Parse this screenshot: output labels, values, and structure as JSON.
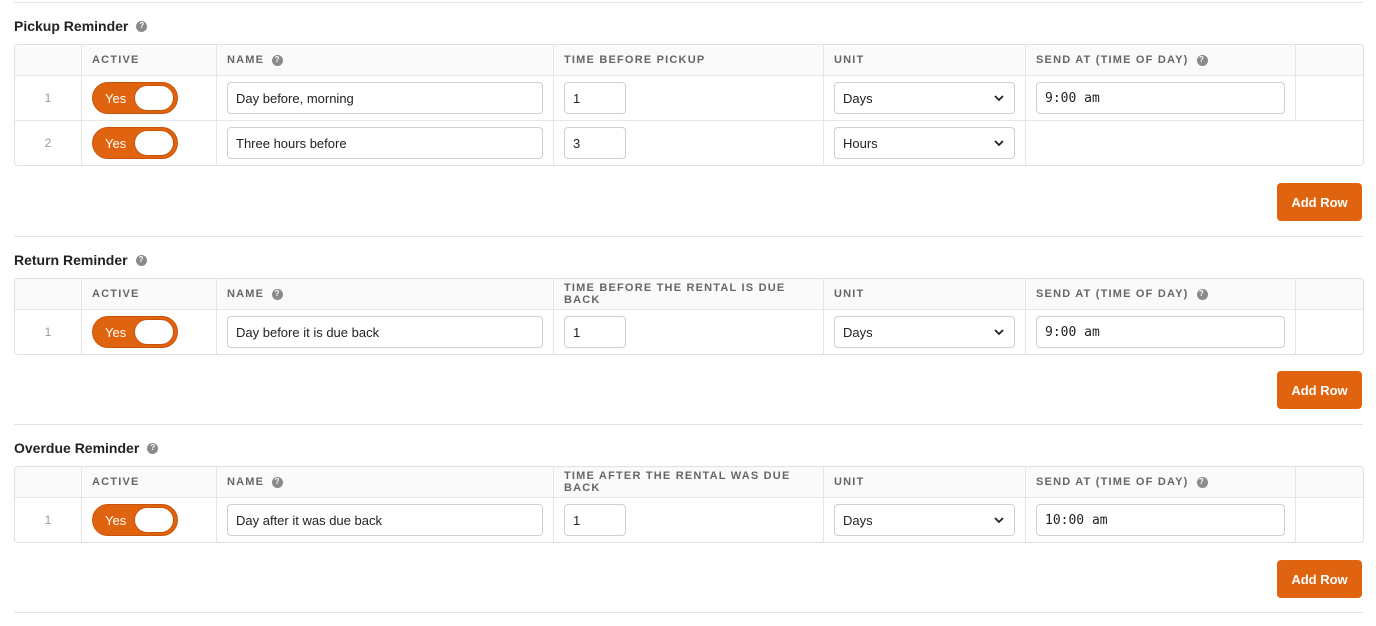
{
  "columns": {
    "active": "Active",
    "name": "Name",
    "unit": "Unit",
    "send_at": "Send at (Time of day)"
  },
  "add_row_label": "Add Row",
  "sections": [
    {
      "title": "Pickup Reminder",
      "time_header": "Time before pickup",
      "rows": [
        {
          "num": "1",
          "active": "Yes",
          "name": "Day before, morning",
          "time": "1",
          "unit": "Days",
          "send_at": "9:00 am"
        },
        {
          "num": "2",
          "active": "Yes",
          "name": "Three hours before",
          "time": "3",
          "unit": "Hours",
          "send_at": ""
        }
      ]
    },
    {
      "title": "Return Reminder",
      "time_header": "Time before the rental is due back",
      "rows": [
        {
          "num": "1",
          "active": "Yes",
          "name": "Day before it is due back",
          "time": "1",
          "unit": "Days",
          "send_at": "9:00 am"
        }
      ]
    },
    {
      "title": "Overdue Reminder",
      "time_header": "Time after the rental was due back",
      "rows": [
        {
          "num": "1",
          "active": "Yes",
          "name": "Day after it was due back",
          "time": "1",
          "unit": "Days",
          "send_at": "10:00 am"
        }
      ]
    }
  ],
  "colors": {
    "accent": "#e0640f"
  }
}
